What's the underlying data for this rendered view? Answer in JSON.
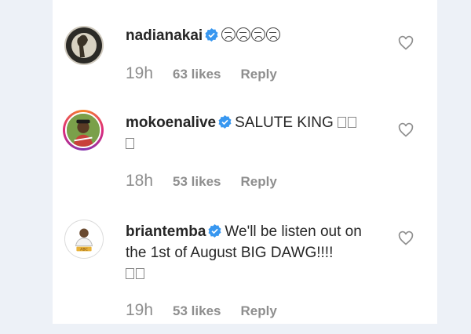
{
  "comments": [
    {
      "username": "nadianakai",
      "verified": true,
      "body": "",
      "emoji_count": 4,
      "time": "19h",
      "likes": "63 likes",
      "reply": "Reply"
    },
    {
      "username": "mokoenalive",
      "verified": true,
      "body": "SALUTE KING",
      "time": "18h",
      "likes": "53 likes",
      "reply": "Reply"
    },
    {
      "username": "briantemba",
      "verified": true,
      "body": "We'll be listen out on the 1st of August BIG DAWG!!!!",
      "time": "19h",
      "likes": "53 likes",
      "reply": "Reply"
    }
  ],
  "colors": {
    "verified_blue": "#3897f0",
    "meta_gray": "#8e8e8e",
    "text": "#262626"
  }
}
